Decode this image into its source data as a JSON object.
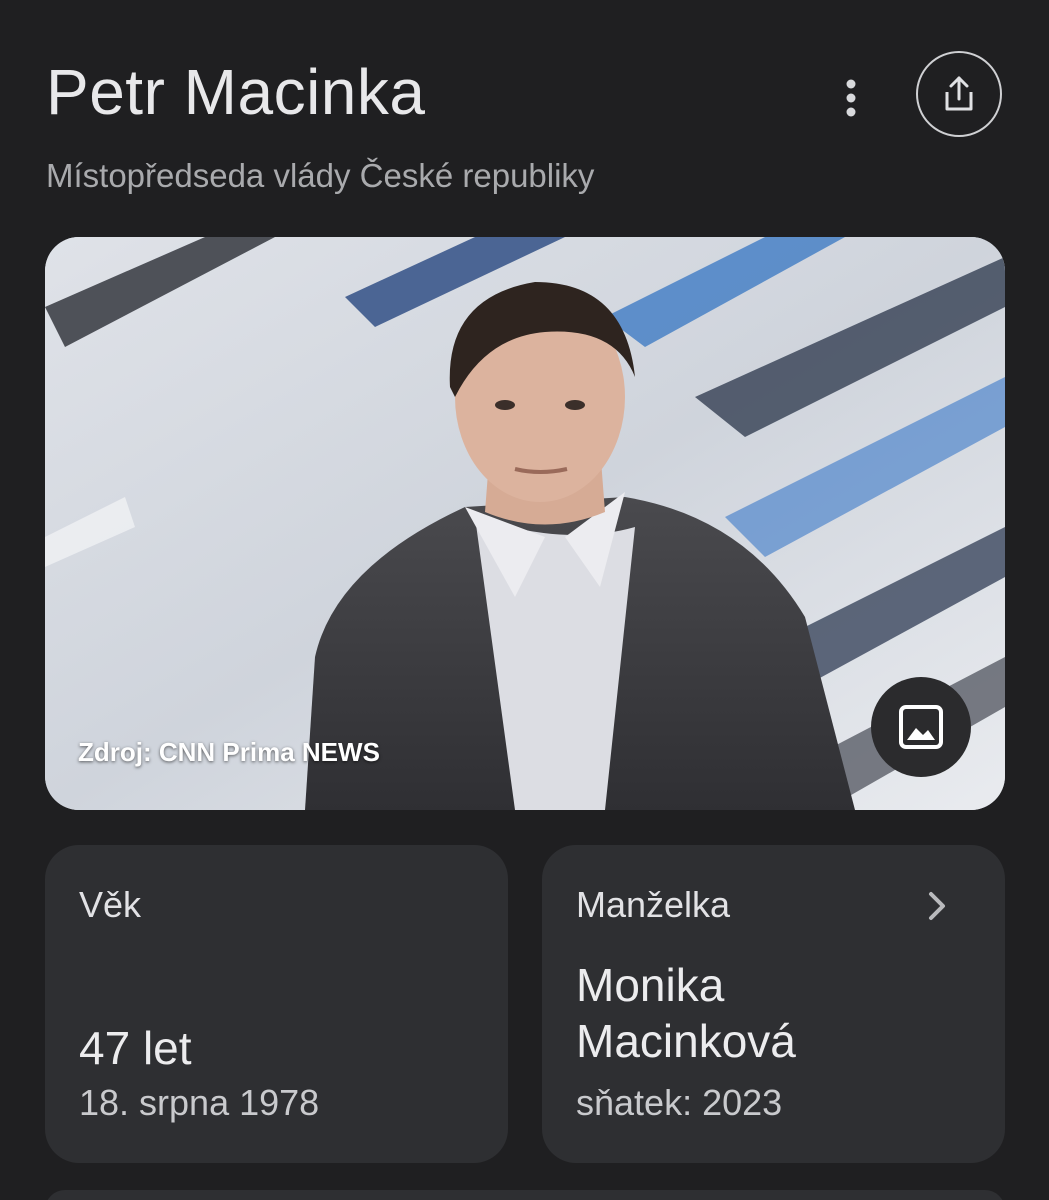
{
  "header": {
    "title": "Petr Macinka",
    "subtitle": "Místopředseda vlády České republiky",
    "more_icon": "more-vert-icon",
    "share_icon": "share-icon"
  },
  "image": {
    "source": "Zdroj: CNN Prima NEWS",
    "image_icon": "image-icon"
  },
  "cards": {
    "age": {
      "label": "Věk",
      "value": "47 let",
      "date": "18. srpna 1978"
    },
    "spouse": {
      "label": "Manželka",
      "name_line1": "Monika",
      "name_line2": "Macinková",
      "married": "sňatek: 2023",
      "chevron_icon": "chevron-right-icon"
    }
  },
  "colors": {
    "background": "#1f1f21",
    "card": "#2e2f32",
    "text_primary": "#e8e8ea",
    "text_secondary": "#a9aaad"
  }
}
